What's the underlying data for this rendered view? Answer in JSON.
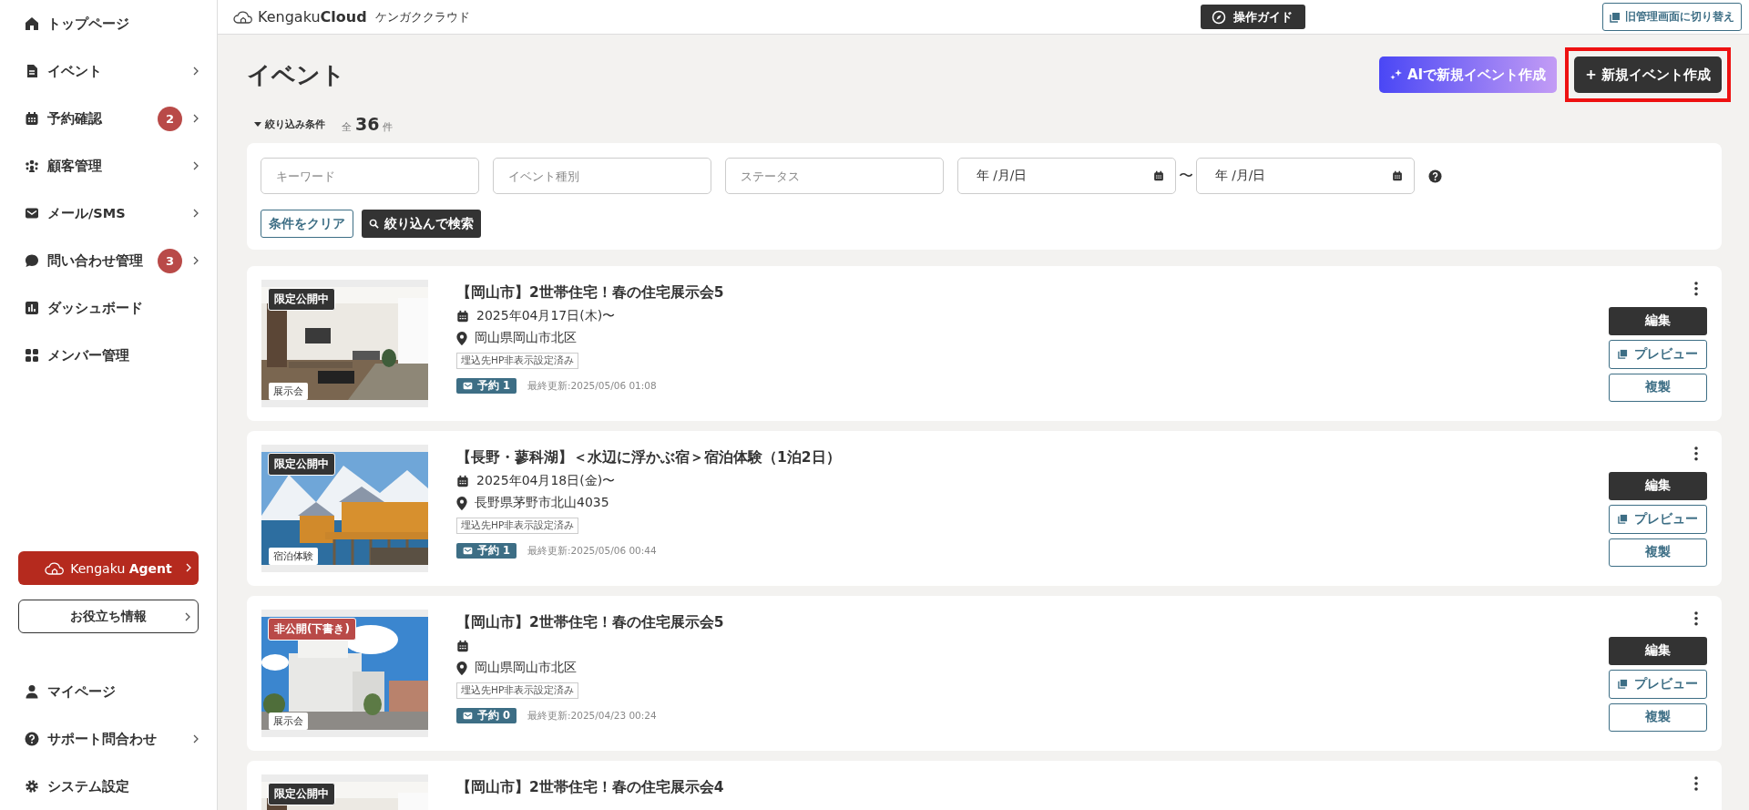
{
  "header": {
    "logo": "Kengaku**Cloud**",
    "logo_sub": "ケンガククラウド",
    "guide_button": "操作ガイド",
    "switch_button": "旧管理画面に切り替え"
  },
  "sidebar": {
    "items": [
      {
        "label": "トップページ",
        "expandable": false
      },
      {
        "label": "イベント",
        "expandable": true
      },
      {
        "label": "予約確認",
        "badge": "2",
        "expandable": true
      },
      {
        "label": "顧客管理",
        "expandable": true
      },
      {
        "label": "メール/SMS",
        "expandable": true
      },
      {
        "label": "問い合わせ管理",
        "badge": "3",
        "expandable": true
      },
      {
        "label": "ダッシュボード",
        "expandable": false
      },
      {
        "label": "メンバー管理",
        "expandable": false
      }
    ],
    "agent_button": "Kengaku **Agent**",
    "info_button": "お役立ち情報",
    "bottom_items": [
      {
        "label": "マイページ",
        "expandable": false
      },
      {
        "label": "サポート問合わせ",
        "expandable": true
      },
      {
        "label": "システム設定",
        "expandable": false
      }
    ]
  },
  "main": {
    "title": "イベント",
    "ai_button": "AIで新規イベント作成",
    "new_button": {
      "label": "+ 新規イベント作成",
      "highlighted": true
    }
  },
  "filter": {
    "toggle": "絞り込み条件",
    "expanded": true,
    "count_prefix": "全",
    "count": "36",
    "count_suffix": "件",
    "fields": [
      {
        "placeholder": "キーワード"
      },
      {
        "placeholder": "イベント種別"
      },
      {
        "placeholder": "ステータス"
      }
    ],
    "date_from": {
      "placeholder": "年 /月/日"
    },
    "range_separator": "〜",
    "date_to": {
      "placeholder": "年 /月/日"
    },
    "clear_button": "条件をクリア",
    "search_button": "絞り込んで検索"
  },
  "events": [
    {
      "status": {
        "label": "限定公開中",
        "kind": "limited"
      },
      "category": "展示会",
      "title": "【岡山市】2世帯住宅！春の住宅展示会5",
      "date": "2025年04月17日(木)〜",
      "location": "岡山県岡山市北区",
      "tag": "埋込先HP非表示設定済み",
      "reservation": "予約 1",
      "updated": "最終更新:2025/05/06 01:08",
      "actions": [
        {
          "label": "編集",
          "kind": "primary"
        },
        {
          "label": "プレビュー",
          "kind": "preview"
        },
        {
          "label": "複製",
          "kind": "outline"
        }
      ]
    },
    {
      "status": {
        "label": "限定公開中",
        "kind": "limited"
      },
      "category": "宿泊体験",
      "title": "【長野・蓼科湖】＜水辺に浮かぶ宿＞宿泊体験（1泊2日）",
      "date": "2025年04月18日(金)〜",
      "location": "長野県茅野市北山4035",
      "tag": "埋込先HP非表示設定済み",
      "reservation": "予約 1",
      "updated": "最終更新:2025/05/06 00:44",
      "actions": [
        {
          "label": "編集",
          "kind": "primary"
        },
        {
          "label": "プレビュー",
          "kind": "preview"
        },
        {
          "label": "複製",
          "kind": "outline"
        }
      ]
    },
    {
      "status": {
        "label": "非公開(下書き)",
        "kind": "draft"
      },
      "category": "展示会",
      "title": "【岡山市】2世帯住宅！春の住宅展示会5",
      "location": "岡山県岡山市北区",
      "tag": "埋込先HP非表示設定済み",
      "reservation": "予約 0",
      "updated": "最終更新:2025/04/23 00:24",
      "actions": [
        {
          "label": "編集",
          "kind": "primary"
        },
        {
          "label": "プレビュー",
          "kind": "preview"
        },
        {
          "label": "複製",
          "kind": "outline"
        }
      ]
    },
    {
      "status": {
        "label": "限定公開中",
        "kind": "limited"
      },
      "title": "【岡山市】2世帯住宅！春の住宅展示会4"
    }
  ]
}
